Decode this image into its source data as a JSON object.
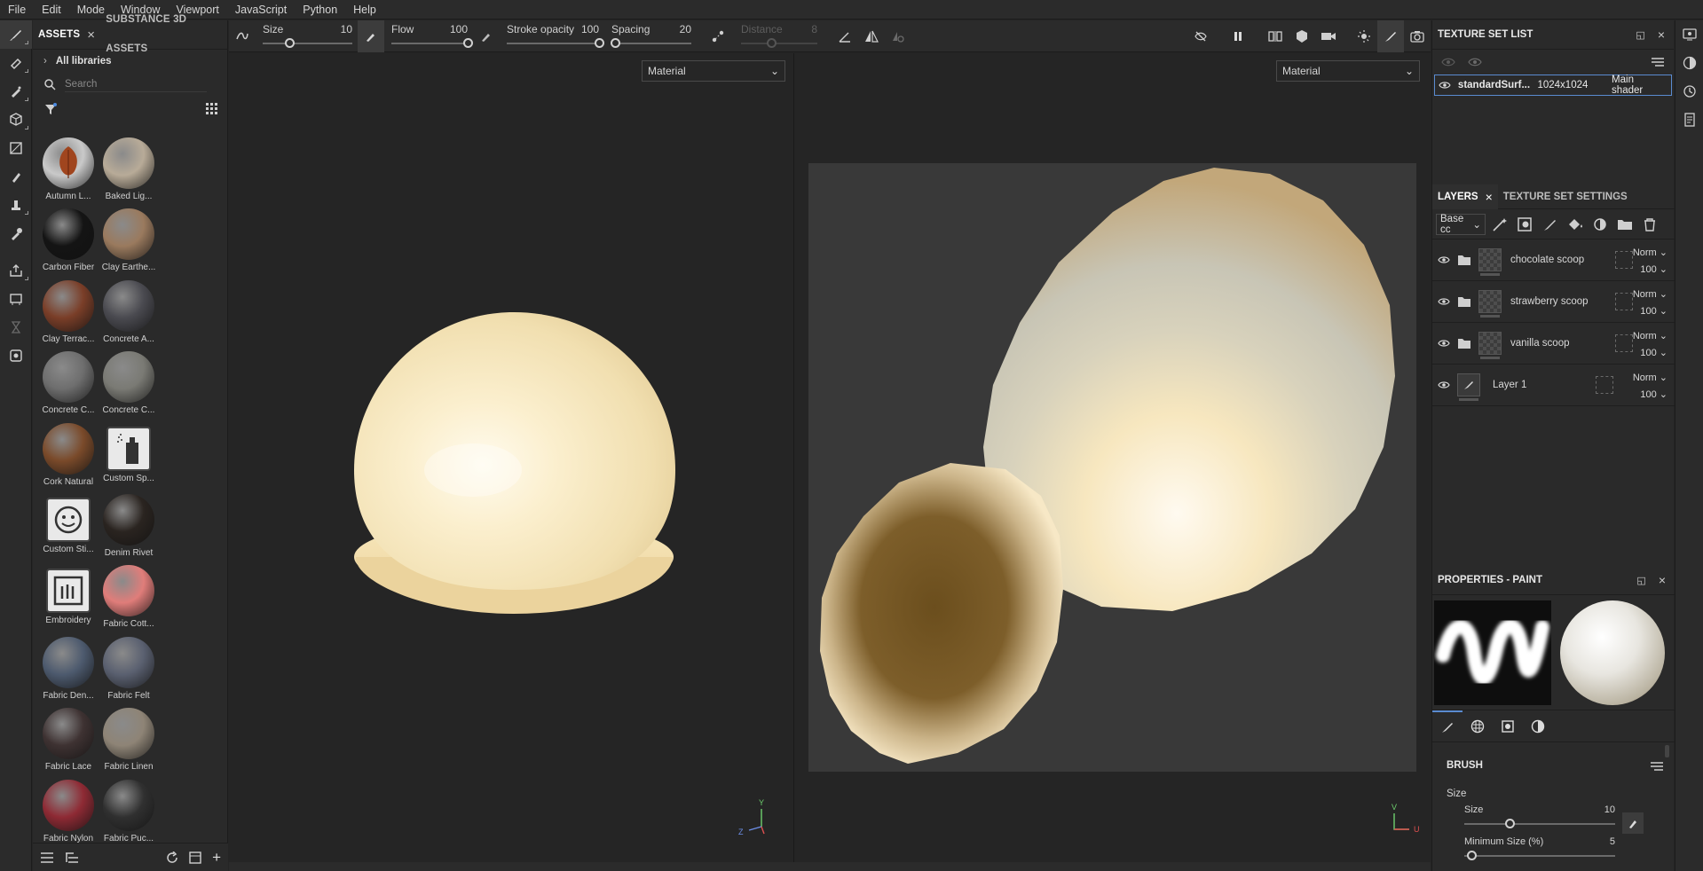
{
  "menu": [
    "File",
    "Edit",
    "Mode",
    "Window",
    "Viewport",
    "JavaScript",
    "Python",
    "Help"
  ],
  "assets_panel": {
    "tabs": [
      {
        "label": "ASSETS",
        "active": true
      },
      {
        "label": "SUBSTANCE 3D ASSETS",
        "active": false
      }
    ],
    "libraries_label": "All libraries",
    "search_placeholder": "Search",
    "items": [
      {
        "label": "Autumn L...",
        "color": "#c9c9c9",
        "icon": "autumn-leaf"
      },
      {
        "label": "Baked Lig...",
        "color": "#b8ab98"
      },
      {
        "label": "Carbon Fiber",
        "color": "#141414"
      },
      {
        "label": "Clay Earthe...",
        "color": "#9a7a5e"
      },
      {
        "label": "Clay Terrac...",
        "color": "#7a3e28"
      },
      {
        "label": "Concrete A...",
        "color": "#4a4a50"
      },
      {
        "label": "Concrete C...",
        "color": "#6e6e6e"
      },
      {
        "label": "Concrete C...",
        "color": "#7a7a74"
      },
      {
        "label": "Cork Natural",
        "color": "#7a4a2a"
      },
      {
        "label": "Custom Sp...",
        "color": "#e6e6e6",
        "icon": "spray-can"
      },
      {
        "label": "Custom Sti...",
        "color": "#e6e6e6",
        "icon": "smiley-sticker"
      },
      {
        "label": "Denim Rivet",
        "color": "#2a2420"
      },
      {
        "label": "Embroidery",
        "color": "#e6e6e6",
        "icon": "embroidery"
      },
      {
        "label": "Fabric Cott...",
        "color": "#e07d7a"
      },
      {
        "label": "Fabric Den...",
        "color": "#4d5a6e"
      },
      {
        "label": "Fabric Felt",
        "color": "#5a6070"
      },
      {
        "label": "Fabric Lace",
        "color": "#3e3232"
      },
      {
        "label": "Fabric Linen",
        "color": "#8e8476"
      },
      {
        "label": "Fabric Nylon",
        "color": "#8e2a34"
      },
      {
        "label": "Fabric Puc...",
        "color": "#303030"
      }
    ]
  },
  "toolbar": {
    "size": {
      "label": "Size",
      "value": "10",
      "fraction": 0.3
    },
    "flow": {
      "label": "Flow",
      "value": "100",
      "fraction": 1.0
    },
    "stroke_opacity": {
      "label": "Stroke opacity",
      "value": "100",
      "fraction": 1.0
    },
    "spacing": {
      "label": "Spacing",
      "value": "20",
      "fraction": 0.05
    },
    "distance": {
      "label": "Distance",
      "value": "8",
      "fraction": 0.4
    }
  },
  "viewports": {
    "left_select": "Material",
    "right_select": "Material"
  },
  "texture_set_list": {
    "title": "TEXTURE SET LIST",
    "row": {
      "name": "standardSurf...",
      "resolution": "1024x1024",
      "shader": "Main shader"
    }
  },
  "layers": {
    "tabs": [
      {
        "label": "LAYERS",
        "active": true
      },
      {
        "label": "TEXTURE SET SETTINGS",
        "active": false
      }
    ],
    "channel": "Base cc",
    "rows": [
      {
        "name": "chocolate scoop",
        "type": "folder",
        "blend": "Norm",
        "opacity": "100"
      },
      {
        "name": "strawberry scoop",
        "type": "folder",
        "blend": "Norm",
        "opacity": "100"
      },
      {
        "name": "vanilla scoop",
        "type": "folder",
        "blend": "Norm",
        "opacity": "100"
      },
      {
        "name": "Layer 1",
        "type": "paint",
        "blend": "Norm",
        "opacity": "100"
      }
    ]
  },
  "properties": {
    "title": "PROPERTIES - PAINT",
    "section": "BRUSH",
    "group": "Size",
    "size": {
      "label": "Size",
      "value": "10",
      "fraction": 0.3
    },
    "min_size": {
      "label": "Minimum Size (%)",
      "value": "5",
      "fraction": 0.05
    }
  },
  "axes": {
    "left": {
      "y": "Y",
      "z": "Z"
    },
    "right": {
      "v": "V",
      "u": "U"
    }
  }
}
